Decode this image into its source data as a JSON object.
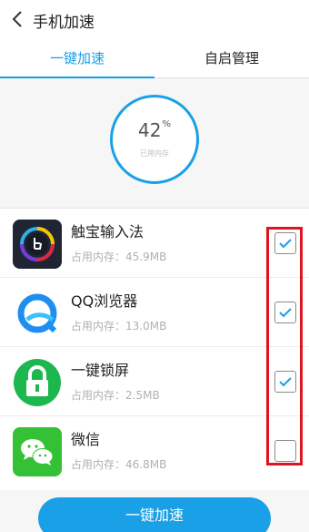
{
  "header": {
    "title": "手机加速"
  },
  "tabs": [
    {
      "label": "一键加速"
    },
    {
      "label": "自启管理"
    }
  ],
  "gauge": {
    "value": "42",
    "unit": "%",
    "label": "已用内存"
  },
  "apps": [
    {
      "name": "触宝输入法",
      "memory": "占用内存：45.9MB",
      "checked": true
    },
    {
      "name": "QQ浏览器",
      "memory": "占用内存：13.0MB",
      "checked": true
    },
    {
      "name": "一键锁屏",
      "memory": "占用内存：2.5MB",
      "checked": true
    },
    {
      "name": "微信",
      "memory": "占用内存：46.8MB",
      "checked": false
    }
  ],
  "action": {
    "label": "一键加速"
  },
  "colors": {
    "accent": "#1aa0e6",
    "highlight": "#e0141e"
  }
}
